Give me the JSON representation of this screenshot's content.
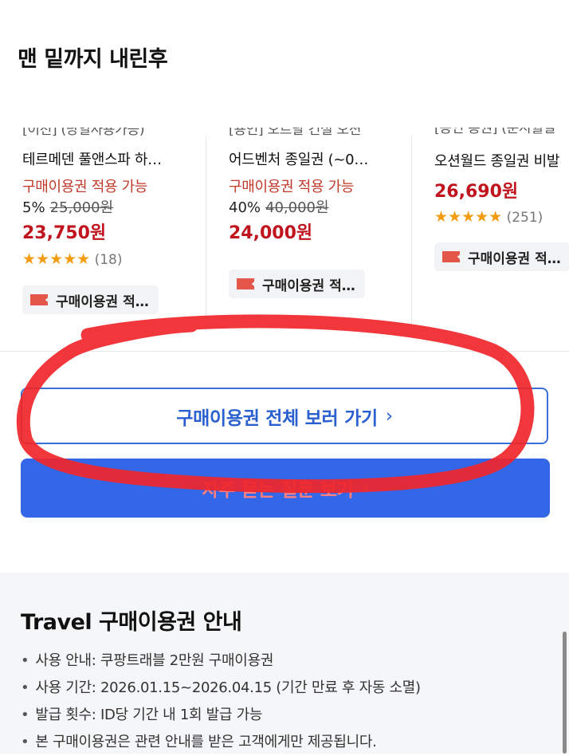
{
  "caption": "맨 밑까지 내린후",
  "products": [
    {
      "cut_label": "[이천] (당일사용가능)",
      "title": "테르메덴 풀앤스파 하…",
      "availability": "구매이용권 적용 가능",
      "discount": "5%",
      "original_price": "25,000원",
      "price": "23,750원",
      "stars": "★★★★★",
      "review_count": "(18)",
      "badge": "구매이용권 적…"
    },
    {
      "cut_label": "[용인] 오르날 건설 오션",
      "title": "어드벤처 종일권 (~0…",
      "availability": "구매이용권 적용 가능",
      "discount": "40%",
      "original_price": "40,000원",
      "price": "24,000원",
      "stars": "",
      "review_count": "",
      "badge": "구매이용권 적…"
    },
    {
      "cut_label": "[용인 통권] (순시월일",
      "title": "오션월드 종일권 비발",
      "availability": "",
      "discount": "",
      "original_price": "",
      "price": "26,690원",
      "stars": "★★★★★",
      "review_count": "(251)",
      "badge": "구매이용권 적…"
    }
  ],
  "buttons": {
    "view_all": "구매이용권 전체 보러 가기",
    "faq": "자주 묻는 질문 보기",
    "chevron": "›"
  },
  "info": {
    "title": "Travel 구매이용권 안내",
    "items": [
      "사용 안내: 쿠팡트래블 2만원 구매이용권",
      "사용 기간: 2026.01.15~2026.04.15 (기간 만료 후 자동 소멸)",
      "발급 횟수: ID당 기간 내 1회 발급 가능",
      "본 구매이용권은 관련 안내를 받은 고객에게만 제공됩니다."
    ]
  },
  "colors": {
    "accent_blue": "#3367e8",
    "price_red": "#c0141e",
    "annotation_red": "#f0262a"
  }
}
